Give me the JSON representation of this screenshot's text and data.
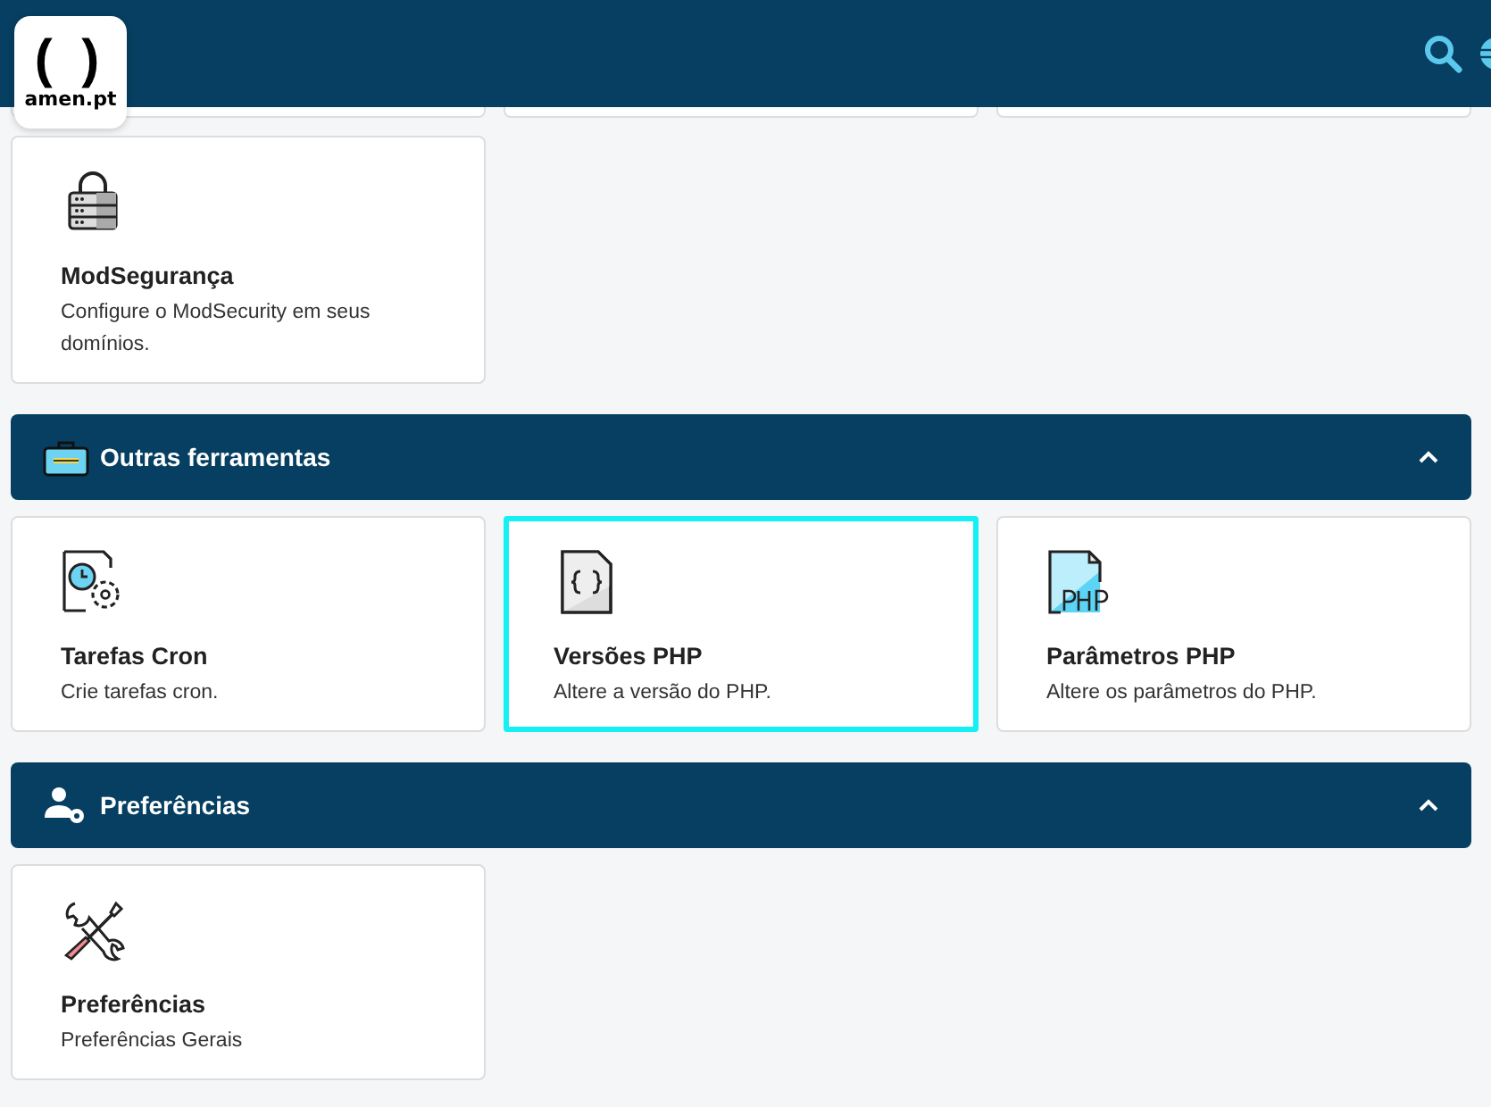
{
  "header": {
    "logo": {
      "mark": "( )",
      "text": "amen.pt"
    }
  },
  "top_cards": [
    {
      "kind": "lock-server",
      "title": "ModSegurança",
      "description": "Configure o ModSecurity em seus domínios.",
      "selected": false
    }
  ],
  "sections": [
    {
      "title": "Outras ferramentas",
      "kind": "toolbox",
      "expanded": true,
      "cards": [
        {
          "kind": "clock-file",
          "title": "Tarefas Cron",
          "description": "Crie tarefas cron.",
          "selected": false
        },
        {
          "kind": "code-file",
          "title": "Versões PHP",
          "description": "Altere a versão do PHP.",
          "selected": true
        },
        {
          "kind": "php-file",
          "title": "Parâmetros PHP",
          "description": "Altere os parâmetros do PHP.",
          "selected": false
        }
      ]
    },
    {
      "title": "Preferências",
      "kind": "user-gear",
      "expanded": true,
      "cards": [
        {
          "kind": "tools",
          "title": "Preferências",
          "description": "Preferências Gerais",
          "selected": false
        }
      ]
    }
  ]
}
